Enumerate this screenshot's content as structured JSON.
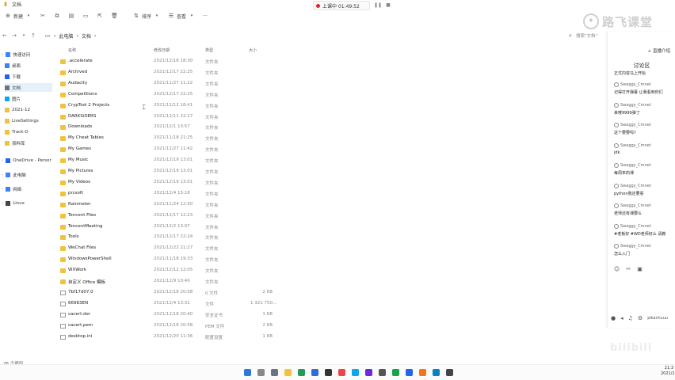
{
  "window": {
    "title": "文档"
  },
  "toolbar": {
    "new_label": "新建",
    "sort_label": "排序",
    "view_label": "查看",
    "more": "···"
  },
  "recording": {
    "text": "上课中 01:49:52"
  },
  "address": {
    "crumbs": [
      "此电脑",
      "文档"
    ]
  },
  "search": {
    "placeholder": "搜索\"文档\""
  },
  "logo": {
    "text": "路飞课堂"
  },
  "sidebar": {
    "items": [
      {
        "label": "快速访问",
        "icon": "star-icon",
        "color": "#3b82f6"
      },
      {
        "label": "桌面",
        "icon": "desktop-icon",
        "color": "#3b82f6"
      },
      {
        "label": "下载",
        "icon": "download-icon",
        "color": "#2563eb"
      },
      {
        "label": "文档",
        "icon": "document-icon",
        "color": "#6b7280"
      },
      {
        "label": "图片",
        "icon": "picture-icon",
        "color": "#0ea5e9"
      },
      {
        "label": "2021-12",
        "icon": "folder-icon",
        "color": "#f0c33c"
      },
      {
        "label": "LiveSettings",
        "icon": "folder-icon",
        "color": "#f0c33c"
      },
      {
        "label": "Track-D",
        "icon": "folder-icon",
        "color": "#f0c33c"
      },
      {
        "label": "资料库",
        "icon": "folder-icon",
        "color": "#f0c33c"
      },
      {
        "label": "OneDrive - Persor",
        "icon": "cloud-icon",
        "color": "#2563eb"
      },
      {
        "label": "此电脑",
        "icon": "computer-icon",
        "color": "#3b82f6"
      },
      {
        "label": "网络",
        "icon": "network-icon",
        "color": "#3b82f6"
      },
      {
        "label": "Linux",
        "icon": "linux-icon",
        "color": "#444444"
      }
    ]
  },
  "columns": {
    "name": "名称",
    "date": "修改日期",
    "type": "类型",
    "size": "大小"
  },
  "files": [
    {
      "name": ".accelerate",
      "date": "2021/12/18 18:30",
      "type": "文件夹",
      "size": "",
      "kind": "folder"
    },
    {
      "name": "Archived",
      "date": "2021/12/17 22:25",
      "type": "文件夹",
      "size": "",
      "kind": "folder"
    },
    {
      "name": "Audacity",
      "date": "2021/11/27 11:22",
      "type": "文件夹",
      "size": "",
      "kind": "folder"
    },
    {
      "name": "Competitions",
      "date": "2021/12/17 22:25",
      "type": "文件夹",
      "size": "",
      "kind": "folder"
    },
    {
      "name": "CrypTool 2 Projects",
      "date": "2021/12/12 18:41",
      "type": "文件夹",
      "size": "",
      "kind": "folder"
    },
    {
      "name": "DARKSiDERS",
      "date": "2021/12/11 22:27",
      "type": "文件夹",
      "size": "",
      "kind": "folder"
    },
    {
      "name": "Downloads",
      "date": "2021/12/1 13:57",
      "type": "文件夹",
      "size": "",
      "kind": "folder"
    },
    {
      "name": "My Cheat Tables",
      "date": "2021/11/18 21:25",
      "type": "文件夹",
      "size": "",
      "kind": "folder"
    },
    {
      "name": "My Games",
      "date": "2021/11/27 11:42",
      "type": "文件夹",
      "size": "",
      "kind": "folder"
    },
    {
      "name": "My Music",
      "date": "2021/12/19 13:01",
      "type": "文件夹",
      "size": "",
      "kind": "folder"
    },
    {
      "name": "My Pictures",
      "date": "2021/12/19 13:01",
      "type": "文件夹",
      "size": "",
      "kind": "folder"
    },
    {
      "name": "My Videos",
      "date": "2021/12/19 13:01",
      "type": "文件夹",
      "size": "",
      "kind": "folder"
    },
    {
      "name": "prcsoft",
      "date": "2021/12/4 15:18",
      "type": "文件夹",
      "size": "",
      "kind": "folder"
    },
    {
      "name": "Rainmeter",
      "date": "2021/11/24 12:50",
      "type": "文件夹",
      "size": "",
      "kind": "folder"
    },
    {
      "name": "Tencent Files",
      "date": "2021/12/17 12:23",
      "type": "文件夹",
      "size": "",
      "kind": "folder"
    },
    {
      "name": "TencentMeeting",
      "date": "2021/12/2 13:07",
      "type": "文件夹",
      "size": "",
      "kind": "folder"
    },
    {
      "name": "Tools",
      "date": "2021/12/17 22:24",
      "type": "文件夹",
      "size": "",
      "kind": "folder"
    },
    {
      "name": "WeChat Files",
      "date": "2021/12/22 21:27",
      "type": "文件夹",
      "size": "",
      "kind": "folder"
    },
    {
      "name": "WindowsPowerShell",
      "date": "2021/11/18 19:33",
      "type": "文件夹",
      "size": "",
      "kind": "folder"
    },
    {
      "name": "WXWork",
      "date": "2021/12/12 12:05",
      "type": "文件夹",
      "size": "",
      "kind": "folder"
    },
    {
      "name": "自定义 Office 模板",
      "date": "2021/12/9 10:40",
      "type": "文件夹",
      "size": "",
      "kind": "folder"
    },
    {
      "name": "7bf17d07.0",
      "date": "2021/12/18 20:58",
      "type": "0 文件",
      "size": "2 KB",
      "kind": "file"
    },
    {
      "name": "66983EN",
      "date": "2021/12/4 13:31",
      "type": "文件",
      "size": "1 321 750...",
      "kind": "file"
    },
    {
      "name": "cacert.der",
      "date": "2021/12/18 20:40",
      "type": "安全证书",
      "size": "1 KB",
      "kind": "file"
    },
    {
      "name": "cacert.pem",
      "date": "2021/12/18 20:58",
      "type": "PEM 文件",
      "size": "2 KB",
      "kind": "file"
    },
    {
      "name": "desktop.ini",
      "date": "2021/12/20 11:36",
      "type": "配置设置",
      "size": "1 KB",
      "kind": "file"
    }
  ],
  "status": {
    "count": "26 个项目"
  },
  "chat": {
    "top_link": "+ 直播介绍",
    "title": "讨论区",
    "notice": "正式内容马上开始",
    "messages": [
      {
        "user": "Swaggy_Cmnet",
        "text": "记得打开弹幕 让我看到你们"
      },
      {
        "user": "Swaggy_Cmnet",
        "text": "来喽9999弹了"
      },
      {
        "user": "Swaggy_Cmnet",
        "text": "这个要要吗?"
      },
      {
        "user": "Swaggy_Cmnet",
        "text": "jdk"
      },
      {
        "user": "Swaggy_Cmnet",
        "text": "每周末的课"
      },
      {
        "user": "Swaggy_Cmnet",
        "text": "python我还要看"
      },
      {
        "user": "Swaggy_Cmnet",
        "text": "老师还有课要么"
      },
      {
        "user": "Swaggy_Cmnet",
        "text": "#老板好 #WD老师好么 请教"
      },
      {
        "user": "Swaggy_Cmnet",
        "text": "怎么入门"
      }
    ],
    "bottom_name": "pikachuuu"
  },
  "watermark": {
    "text": "bilibili"
  },
  "clock": {
    "time": "21:3",
    "date": "2021/12/2"
  }
}
